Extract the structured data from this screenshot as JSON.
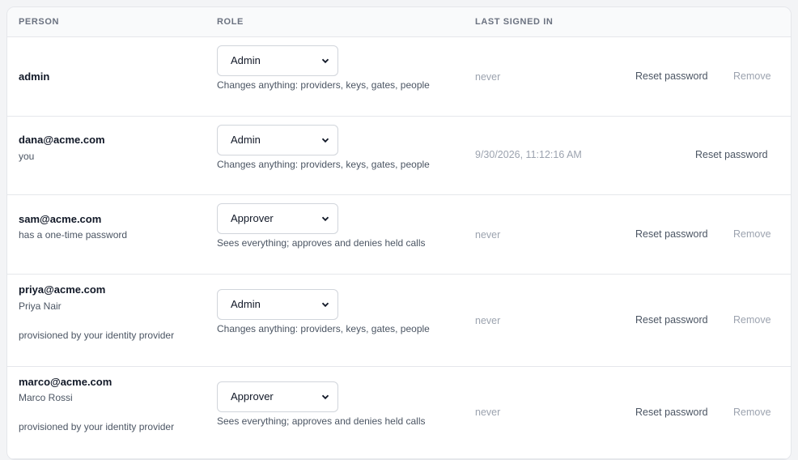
{
  "table": {
    "headers": {
      "person": "PERSON",
      "role": "ROLE",
      "last_signed_in": "LAST SIGNED IN"
    },
    "rows": [
      {
        "email": "admin",
        "role": "Admin",
        "role_description": "Changes anything: providers, keys, gates, people",
        "last_signed_in": "never",
        "reset_label": "Reset password",
        "remove_label": "Remove"
      },
      {
        "email": "dana@acme.com",
        "sub": "you",
        "role": "Admin",
        "role_description": "Changes anything: providers, keys, gates, people",
        "last_signed_in": "9/30/2026, 11:12:16 AM",
        "reset_label": "Reset password"
      },
      {
        "email": "sam@acme.com",
        "sub": "has a one-time password",
        "role": "Approver",
        "role_description": "Sees everything; approves and denies held calls",
        "last_signed_in": "never",
        "reset_label": "Reset password",
        "remove_label": "Remove"
      },
      {
        "email": "priya@acme.com",
        "name": "Priya Nair",
        "provisioned": "provisioned by your identity provider",
        "role": "Admin",
        "role_description": "Changes anything: providers, keys, gates, people",
        "last_signed_in": "never",
        "reset_label": "Reset password",
        "remove_label": "Remove"
      },
      {
        "email": "marco@acme.com",
        "name": "Marco Rossi",
        "provisioned": "provisioned by your identity provider",
        "role": "Approver",
        "role_description": "Sees everything; approves and denies held calls",
        "last_signed_in": "never",
        "reset_label": "Reset password",
        "remove_label": "Remove"
      }
    ]
  },
  "colors": {
    "border": "#e5e7eb",
    "header_bg": "#f9fafb",
    "muted": "#9ca3af",
    "text": "#111827"
  },
  "icons": {
    "select_chevron": "chevron-down-icon"
  }
}
